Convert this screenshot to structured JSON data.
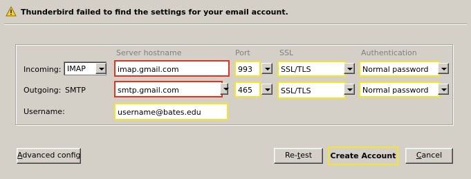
{
  "warning": {
    "text": "Thunderbird failed to find the settings for your email account."
  },
  "columns": {
    "server_hostname": "Server hostname",
    "port": "Port",
    "ssl": "SSL",
    "authentication": "Authentication"
  },
  "incoming": {
    "label": "Incoming:",
    "protocol": "IMAP",
    "hostname": "imap.gmail.com",
    "port": "993",
    "ssl": "SSL/TLS",
    "auth": "Normal password"
  },
  "outgoing": {
    "label": "Outgoing:",
    "protocol": "SMTP",
    "hostname": "smtp.gmail.com",
    "port": "465",
    "ssl": "SSL/TLS",
    "auth": "Normal password"
  },
  "username": {
    "label": "Username:",
    "value": "username@bates.edu"
  },
  "buttons": {
    "advanced_config_u": "A",
    "advanced_config_rest": "dvanced config",
    "retest_pre": "Re-",
    "retest_u": "t",
    "retest_post": "est",
    "create_account": "Create Account",
    "cancel_pre": "",
    "cancel_u": "C",
    "cancel_post": "ancel"
  },
  "colors": {
    "highlight_red": "#e8301a",
    "highlight_yellow": "#f5e52a",
    "dialog_bg": "#d4d0c8"
  },
  "icons": {
    "warning": "warning-triangle-icon"
  }
}
